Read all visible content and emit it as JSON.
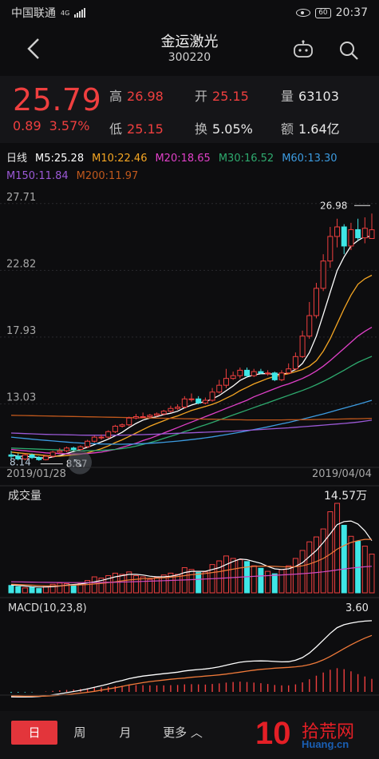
{
  "status": {
    "carrier": "中国联通",
    "net": "4G",
    "battery": "60",
    "time": "20:37"
  },
  "header": {
    "title": "金运激光",
    "code": "300220"
  },
  "quote": {
    "price": "25.79",
    "change": "0.89",
    "change_pct": "3.57%",
    "high_label": "高",
    "high": "26.98",
    "low_label": "低",
    "low": "25.15",
    "open_label": "开",
    "open": "25.15",
    "turnover_label": "换",
    "turnover": "5.05%",
    "volume_label": "量",
    "volume": "63103",
    "amount_label": "额",
    "amount": "1.64亿"
  },
  "ma_legend": {
    "period": "日线",
    "ma5": "M5:25.28",
    "ma10": "M10:22.46",
    "ma20": "M20:18.65",
    "ma30": "M30:16.52",
    "ma60": "M60:13.30",
    "ma150": "M150:11.84",
    "ma200": "M200:11.97"
  },
  "colors": {
    "up": "#ef3f3f",
    "down": "#3fe6e6",
    "ma5": "#ffffff",
    "ma10": "#f5a623",
    "ma20": "#e040c8",
    "ma30": "#2eaa6e",
    "ma60": "#3c9be0",
    "ma150": "#9b59d6",
    "ma200": "#c0581c"
  },
  "chart_data": {
    "type": "candlestick",
    "y_ticks": [
      "27.71",
      "22.82",
      "17.93",
      "13.03"
    ],
    "ylim": [
      8.5,
      28.4
    ],
    "date_start": "2019/01/28",
    "date_end": "2019/04/04",
    "annotations": {
      "high_label": "26.98",
      "low_label": "8.87",
      "low_cut": "8.14"
    },
    "candles": [
      [
        9.3,
        9.2,
        9.6,
        9.0
      ],
      [
        9.2,
        9.0,
        9.4,
        8.9
      ],
      [
        9.0,
        9.3,
        9.4,
        8.9
      ],
      [
        9.3,
        9.1,
        9.4,
        9.0
      ],
      [
        9.1,
        8.95,
        9.2,
        8.87
      ],
      [
        8.95,
        9.2,
        9.3,
        8.9
      ],
      [
        9.2,
        9.5,
        9.6,
        9.1
      ],
      [
        9.5,
        9.6,
        9.8,
        9.4
      ],
      [
        9.6,
        9.8,
        9.9,
        9.5
      ],
      [
        9.8,
        9.7,
        9.9,
        9.6
      ],
      [
        9.7,
        9.9,
        10.0,
        9.6
      ],
      [
        9.9,
        10.3,
        10.4,
        9.8
      ],
      [
        10.3,
        10.6,
        10.7,
        10.2
      ],
      [
        10.6,
        10.6,
        10.8,
        10.4
      ],
      [
        10.6,
        11.0,
        11.1,
        10.5
      ],
      [
        11.0,
        11.4,
        11.5,
        10.9
      ],
      [
        11.4,
        11.5,
        11.6,
        11.3
      ],
      [
        11.5,
        12.0,
        12.1,
        11.4
      ],
      [
        12.0,
        12.1,
        12.3,
        11.9
      ],
      [
        12.1,
        12.1,
        12.4,
        12.0
      ],
      [
        12.1,
        12.2,
        12.3,
        12.0
      ],
      [
        12.2,
        12.3,
        12.4,
        12.1
      ],
      [
        12.3,
        12.5,
        12.6,
        12.2
      ],
      [
        12.5,
        12.7,
        12.9,
        12.4
      ],
      [
        12.7,
        12.8,
        13.0,
        12.6
      ],
      [
        12.8,
        13.4,
        13.6,
        12.7
      ],
      [
        13.4,
        13.4,
        13.8,
        13.2
      ],
      [
        13.4,
        13.1,
        13.6,
        13.0
      ],
      [
        13.1,
        13.3,
        13.5,
        13.0
      ],
      [
        13.3,
        13.9,
        14.2,
        13.2
      ],
      [
        13.9,
        14.4,
        14.8,
        13.8
      ],
      [
        14.4,
        14.9,
        15.6,
        14.2
      ],
      [
        14.9,
        15.1,
        15.4,
        14.8
      ],
      [
        15.1,
        15.5,
        15.7,
        14.9
      ],
      [
        15.5,
        15.1,
        15.7,
        15.0
      ],
      [
        15.1,
        15.4,
        15.6,
        15.0
      ],
      [
        15.4,
        15.3,
        15.6,
        15.2
      ],
      [
        15.3,
        15.3,
        15.5,
        15.1
      ],
      [
        15.3,
        14.8,
        15.4,
        14.7
      ],
      [
        14.8,
        15.3,
        15.5,
        14.7
      ],
      [
        15.3,
        15.6,
        16.0,
        15.2
      ],
      [
        15.6,
        16.5,
        16.8,
        15.5
      ],
      [
        16.5,
        18.0,
        18.4,
        16.4
      ],
      [
        18.0,
        19.5,
        20.5,
        17.8
      ],
      [
        19.5,
        21.5,
        21.9,
        19.3
      ],
      [
        21.5,
        23.5,
        24.0,
        21.3
      ],
      [
        23.5,
        25.3,
        26.0,
        23.0
      ],
      [
        25.3,
        26.0,
        26.6,
        24.5
      ],
      [
        26.0,
        24.6,
        26.2,
        24.0
      ],
      [
        24.6,
        25.8,
        26.3,
        24.3
      ],
      [
        25.8,
        25.2,
        26.6,
        25.0
      ],
      [
        25.2,
        25.9,
        26.7,
        24.8
      ],
      [
        25.15,
        25.79,
        26.98,
        25.15
      ]
    ],
    "series": [
      {
        "name": "M5",
        "values": [
          9.3,
          9.2,
          9.2,
          9.15,
          9.1,
          9.05,
          9.15,
          9.25,
          9.4,
          9.55,
          9.7,
          9.85,
          10.05,
          10.25,
          10.45,
          10.7,
          10.95,
          11.3,
          11.6,
          11.85,
          12.0,
          12.1,
          12.25,
          12.35,
          12.5,
          12.75,
          12.95,
          13.1,
          13.2,
          13.4,
          13.65,
          14.0,
          14.35,
          14.75,
          15.0,
          15.15,
          15.25,
          15.25,
          15.2,
          15.2,
          15.3,
          15.55,
          16.0,
          16.8,
          18.0,
          19.6,
          21.2,
          22.8,
          23.8,
          24.6,
          25.0,
          25.3,
          25.28
        ]
      },
      {
        "name": "M10",
        "values": [
          9.5,
          9.45,
          9.4,
          9.35,
          9.3,
          9.25,
          9.2,
          9.2,
          9.25,
          9.3,
          9.35,
          9.45,
          9.6,
          9.75,
          9.95,
          10.2,
          10.4,
          10.65,
          10.9,
          11.15,
          11.4,
          11.6,
          11.8,
          12.0,
          12.15,
          12.35,
          12.55,
          12.7,
          12.85,
          13.0,
          13.2,
          13.45,
          13.7,
          14.0,
          14.25,
          14.5,
          14.7,
          14.9,
          15.05,
          15.15,
          15.25,
          15.4,
          15.55,
          15.8,
          16.2,
          16.9,
          17.8,
          18.9,
          20.0,
          21.0,
          21.8,
          22.2,
          22.46
        ]
      },
      {
        "name": "M20",
        "values": [
          9.7,
          9.65,
          9.6,
          9.55,
          9.5,
          9.45,
          9.42,
          9.4,
          9.38,
          9.37,
          9.37,
          9.4,
          9.45,
          9.5,
          9.6,
          9.7,
          9.85,
          10.0,
          10.15,
          10.35,
          10.5,
          10.7,
          10.9,
          11.1,
          11.3,
          11.5,
          11.7,
          11.9,
          12.1,
          12.3,
          12.5,
          12.7,
          12.9,
          13.1,
          13.3,
          13.55,
          13.75,
          13.95,
          14.15,
          14.35,
          14.5,
          14.7,
          14.9,
          15.15,
          15.45,
          15.8,
          16.2,
          16.65,
          17.1,
          17.55,
          18.0,
          18.35,
          18.65
        ]
      },
      {
        "name": "M30",
        "values": [
          9.8,
          9.78,
          9.76,
          9.74,
          9.72,
          9.7,
          9.68,
          9.66,
          9.64,
          9.62,
          9.6,
          9.6,
          9.61,
          9.63,
          9.66,
          9.7,
          9.76,
          9.84,
          9.94,
          10.06,
          10.2,
          10.34,
          10.5,
          10.66,
          10.82,
          11.0,
          11.16,
          11.34,
          11.5,
          11.68,
          11.86,
          12.04,
          12.22,
          12.4,
          12.58,
          12.76,
          12.94,
          13.12,
          13.3,
          13.48,
          13.66,
          13.84,
          14.02,
          14.22,
          14.44,
          14.68,
          14.94,
          15.22,
          15.5,
          15.8,
          16.08,
          16.3,
          16.52
        ]
      },
      {
        "name": "M60",
        "values": [
          10.6,
          10.55,
          10.5,
          10.45,
          10.4,
          10.36,
          10.32,
          10.28,
          10.24,
          10.2,
          10.17,
          10.14,
          10.12,
          10.1,
          10.09,
          10.08,
          10.08,
          10.09,
          10.1,
          10.12,
          10.15,
          10.18,
          10.22,
          10.26,
          10.31,
          10.36,
          10.42,
          10.48,
          10.55,
          10.62,
          10.7,
          10.78,
          10.87,
          10.96,
          11.05,
          11.15,
          11.25,
          11.35,
          11.46,
          11.57,
          11.68,
          11.8,
          11.92,
          12.04,
          12.17,
          12.3,
          12.44,
          12.58,
          12.72,
          12.86,
          13.0,
          13.15,
          13.3
        ]
      },
      {
        "name": "M150",
        "values": [
          10.9,
          10.88,
          10.86,
          10.84,
          10.82,
          10.8,
          10.79,
          10.78,
          10.77,
          10.76,
          10.75,
          10.74,
          10.74,
          10.74,
          10.74,
          10.74,
          10.75,
          10.76,
          10.77,
          10.78,
          10.8,
          10.82,
          10.84,
          10.86,
          10.88,
          10.9,
          10.92,
          10.94,
          10.96,
          10.98,
          11.0,
          11.02,
          11.04,
          11.07,
          11.1,
          11.13,
          11.16,
          11.19,
          11.22,
          11.25,
          11.28,
          11.32,
          11.36,
          11.4,
          11.44,
          11.48,
          11.52,
          11.56,
          11.6,
          11.65,
          11.7,
          11.77,
          11.84
        ]
      },
      {
        "name": "M200",
        "values": [
          12.2,
          12.19,
          12.18,
          12.17,
          12.16,
          12.15,
          12.14,
          12.13,
          12.12,
          12.11,
          12.1,
          12.09,
          12.08,
          12.07,
          12.06,
          12.05,
          12.04,
          12.03,
          12.02,
          12.01,
          12.0,
          11.99,
          11.98,
          11.97,
          11.96,
          11.95,
          11.94,
          11.93,
          11.92,
          11.91,
          11.9,
          11.89,
          11.88,
          11.87,
          11.86,
          11.86,
          11.86,
          11.86,
          11.86,
          11.86,
          11.87,
          11.87,
          11.88,
          11.88,
          11.89,
          11.9,
          11.91,
          11.92,
          11.93,
          11.94,
          11.95,
          11.96,
          11.97
        ]
      }
    ],
    "volume": {
      "label": "成交量",
      "max_label": "14.57万",
      "max": 14.57,
      "values": [
        1.2,
        1.0,
        0.8,
        0.9,
        0.7,
        1.0,
        1.4,
        1.6,
        1.5,
        1.3,
        1.5,
        2.0,
        2.6,
        2.4,
        2.8,
        3.2,
        3.0,
        3.4,
        2.8,
        2.6,
        2.2,
        2.5,
        2.9,
        3.2,
        3.0,
        4.1,
        3.8,
        3.3,
        3.4,
        4.6,
        5.2,
        6.0,
        5.6,
        5.4,
        5.1,
        4.4,
        4.0,
        3.5,
        3.1,
        3.8,
        4.4,
        5.6,
        6.9,
        8.3,
        9.1,
        10.4,
        13.2,
        14.57,
        11.0,
        9.2,
        8.4,
        7.6,
        6.3
      ],
      "ma1": [
        1.3,
        1.2,
        1.1,
        1.0,
        0.95,
        0.95,
        1.0,
        1.1,
        1.25,
        1.35,
        1.45,
        1.6,
        1.8,
        2.0,
        2.3,
        2.6,
        2.8,
        3.0,
        3.0,
        2.9,
        2.7,
        2.6,
        2.6,
        2.7,
        2.9,
        3.3,
        3.5,
        3.5,
        3.5,
        3.8,
        4.1,
        4.6,
        5.1,
        5.5,
        5.4,
        5.1,
        4.8,
        4.3,
        3.9,
        3.8,
        3.9,
        4.3,
        4.9,
        5.9,
        6.9,
        8.2,
        9.6,
        11.1,
        11.6,
        11.7,
        11.2,
        10.1,
        8.5
      ],
      "ma2": [
        1.4,
        1.35,
        1.3,
        1.25,
        1.2,
        1.15,
        1.15,
        1.15,
        1.2,
        1.25,
        1.3,
        1.35,
        1.45,
        1.55,
        1.65,
        1.8,
        1.95,
        2.1,
        2.2,
        2.3,
        2.35,
        2.4,
        2.45,
        2.55,
        2.65,
        2.8,
        2.95,
        3.05,
        3.15,
        3.3,
        3.45,
        3.65,
        3.85,
        4.05,
        4.2,
        4.3,
        4.35,
        4.35,
        4.3,
        4.25,
        4.2,
        4.25,
        4.4,
        4.7,
        5.1,
        5.6,
        6.3,
        7.1,
        7.7,
        8.2,
        8.5,
        8.7,
        8.7
      ],
      "ma3": [
        1.8,
        1.78,
        1.76,
        1.74,
        1.72,
        1.7,
        1.69,
        1.68,
        1.67,
        1.66,
        1.66,
        1.66,
        1.67,
        1.68,
        1.7,
        1.72,
        1.75,
        1.78,
        1.82,
        1.86,
        1.9,
        1.94,
        1.98,
        2.02,
        2.06,
        2.1,
        2.15,
        2.2,
        2.25,
        2.3,
        2.36,
        2.42,
        2.48,
        2.55,
        2.62,
        2.68,
        2.74,
        2.8,
        2.86,
        2.92,
        2.98,
        3.04,
        3.12,
        3.2,
        3.3,
        3.42,
        3.56,
        3.72,
        3.88,
        4.02,
        4.14,
        4.24,
        4.32
      ]
    },
    "macd": {
      "label": "MACD(10,23,8)",
      "value_label": "3.60",
      "hist": [
        -0.05,
        -0.04,
        -0.03,
        -0.02,
        0.0,
        0.02,
        0.05,
        0.08,
        0.1,
        0.12,
        0.15,
        0.18,
        0.21,
        0.23,
        0.26,
        0.29,
        0.31,
        0.33,
        0.34,
        0.34,
        0.33,
        0.33,
        0.33,
        0.34,
        0.35,
        0.38,
        0.39,
        0.38,
        0.37,
        0.4,
        0.43,
        0.47,
        0.5,
        0.52,
        0.5,
        0.47,
        0.44,
        0.4,
        0.35,
        0.33,
        0.33,
        0.38,
        0.48,
        0.64,
        0.82,
        0.98,
        1.12,
        1.2,
        1.15,
        1.04,
        0.9,
        0.78,
        0.66
      ],
      "dif": [
        -0.25,
        -0.26,
        -0.26,
        -0.25,
        -0.23,
        -0.2,
        -0.15,
        -0.1,
        -0.04,
        0.02,
        0.08,
        0.15,
        0.23,
        0.31,
        0.4,
        0.5,
        0.58,
        0.67,
        0.74,
        0.8,
        0.84,
        0.88,
        0.92,
        0.96,
        1.0,
        1.06,
        1.1,
        1.13,
        1.16,
        1.21,
        1.27,
        1.35,
        1.43,
        1.5,
        1.54,
        1.56,
        1.57,
        1.56,
        1.54,
        1.52,
        1.53,
        1.6,
        1.74,
        1.97,
        2.28,
        2.62,
        2.96,
        3.25,
        3.4,
        3.48,
        3.54,
        3.58,
        3.6
      ],
      "dea": [
        -0.2,
        -0.21,
        -0.22,
        -0.22,
        -0.22,
        -0.21,
        -0.19,
        -0.17,
        -0.14,
        -0.1,
        -0.06,
        -0.02,
        0.03,
        0.09,
        0.15,
        0.21,
        0.28,
        0.35,
        0.41,
        0.47,
        0.52,
        0.56,
        0.6,
        0.64,
        0.67,
        0.7,
        0.74,
        0.77,
        0.8,
        0.83,
        0.86,
        0.9,
        0.95,
        1.0,
        1.05,
        1.1,
        1.14,
        1.17,
        1.2,
        1.22,
        1.24,
        1.27,
        1.31,
        1.38,
        1.48,
        1.62,
        1.79,
        1.99,
        2.19,
        2.38,
        2.56,
        2.72,
        2.86
      ]
    }
  },
  "tabs": {
    "day": "日",
    "week": "周",
    "month": "月",
    "more": "更多",
    "more_icon": "chevron-up-icon"
  },
  "watermark": {
    "logo": "10",
    "site": "拾荒网",
    "url": "Huang.cn"
  }
}
